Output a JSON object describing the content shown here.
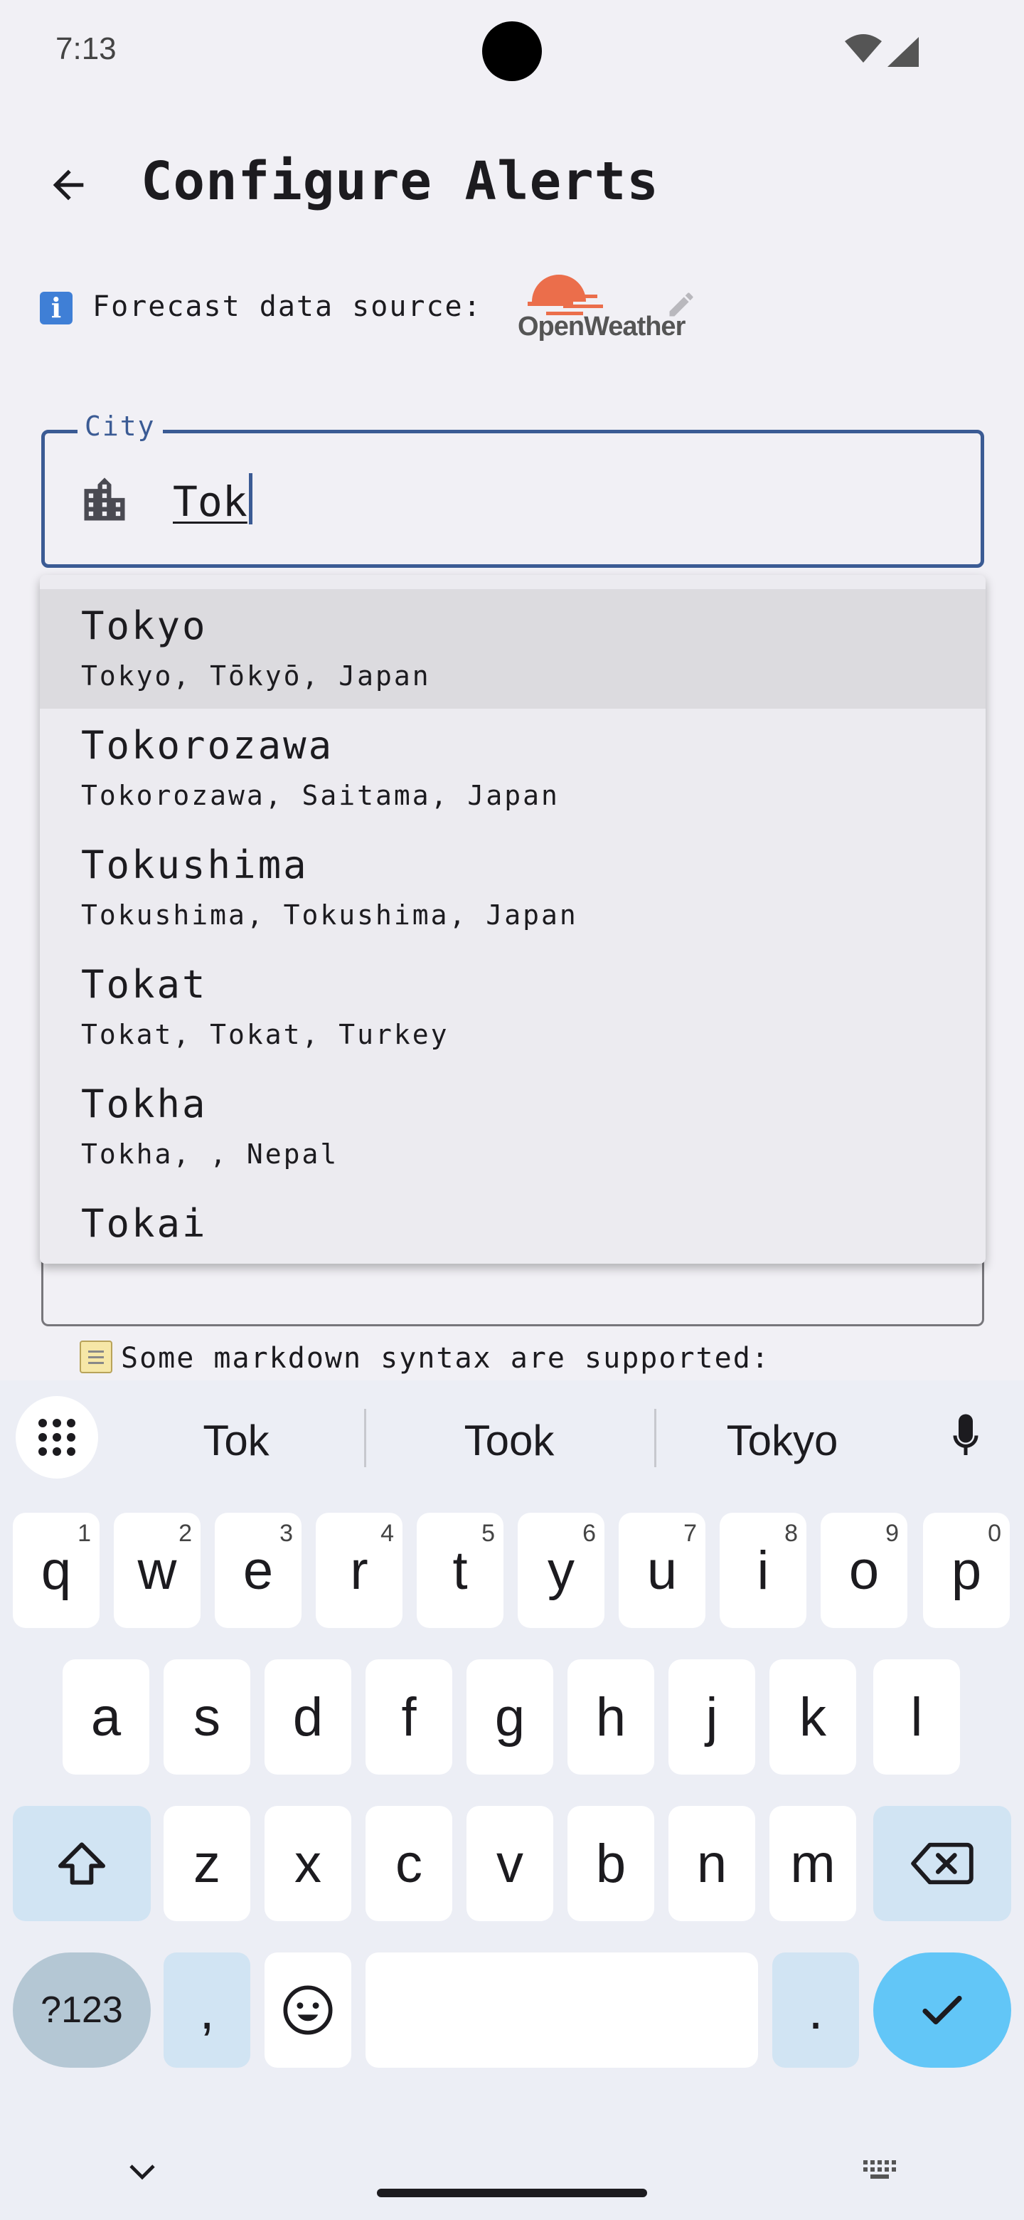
{
  "status_bar": {
    "time": "7:13"
  },
  "app_bar": {
    "title": "Configure Alerts"
  },
  "source": {
    "label": "Forecast data source:",
    "provider": "OpenWeather"
  },
  "city_field": {
    "label": "City",
    "value": "Tok"
  },
  "suggestions": [
    {
      "name": "Tokyo",
      "detail": "Tokyo, Tōkyō, Japan"
    },
    {
      "name": "Tokorozawa",
      "detail": "Tokorozawa, Saitama, Japan"
    },
    {
      "name": "Tokushima",
      "detail": "Tokushima, Tokushima, Japan"
    },
    {
      "name": "Tokat",
      "detail": "Tokat, Tokat, Turkey"
    },
    {
      "name": "Tokha",
      "detail": "Tokha, , Nepal"
    },
    {
      "name": "Tokai",
      "detail": ""
    }
  ],
  "hint": {
    "text": "Some markdown syntax are supported:"
  },
  "keyboard": {
    "suggestions": [
      "Tok",
      "Took",
      "Tokyo"
    ],
    "row1": [
      {
        "k": "q",
        "n": "1"
      },
      {
        "k": "w",
        "n": "2"
      },
      {
        "k": "e",
        "n": "3"
      },
      {
        "k": "r",
        "n": "4"
      },
      {
        "k": "t",
        "n": "5"
      },
      {
        "k": "y",
        "n": "6"
      },
      {
        "k": "u",
        "n": "7"
      },
      {
        "k": "i",
        "n": "8"
      },
      {
        "k": "o",
        "n": "9"
      },
      {
        "k": "p",
        "n": "0"
      }
    ],
    "row2": [
      "a",
      "s",
      "d",
      "f",
      "g",
      "h",
      "j",
      "k",
      "l"
    ],
    "row3": [
      "z",
      "x",
      "c",
      "v",
      "b",
      "n",
      "m"
    ],
    "symbols_label": "?123",
    "comma": ",",
    "period": "."
  },
  "colors": {
    "accent": "#3b5b94",
    "enter": "#62c6f7",
    "logo": "#eb6e4b"
  }
}
